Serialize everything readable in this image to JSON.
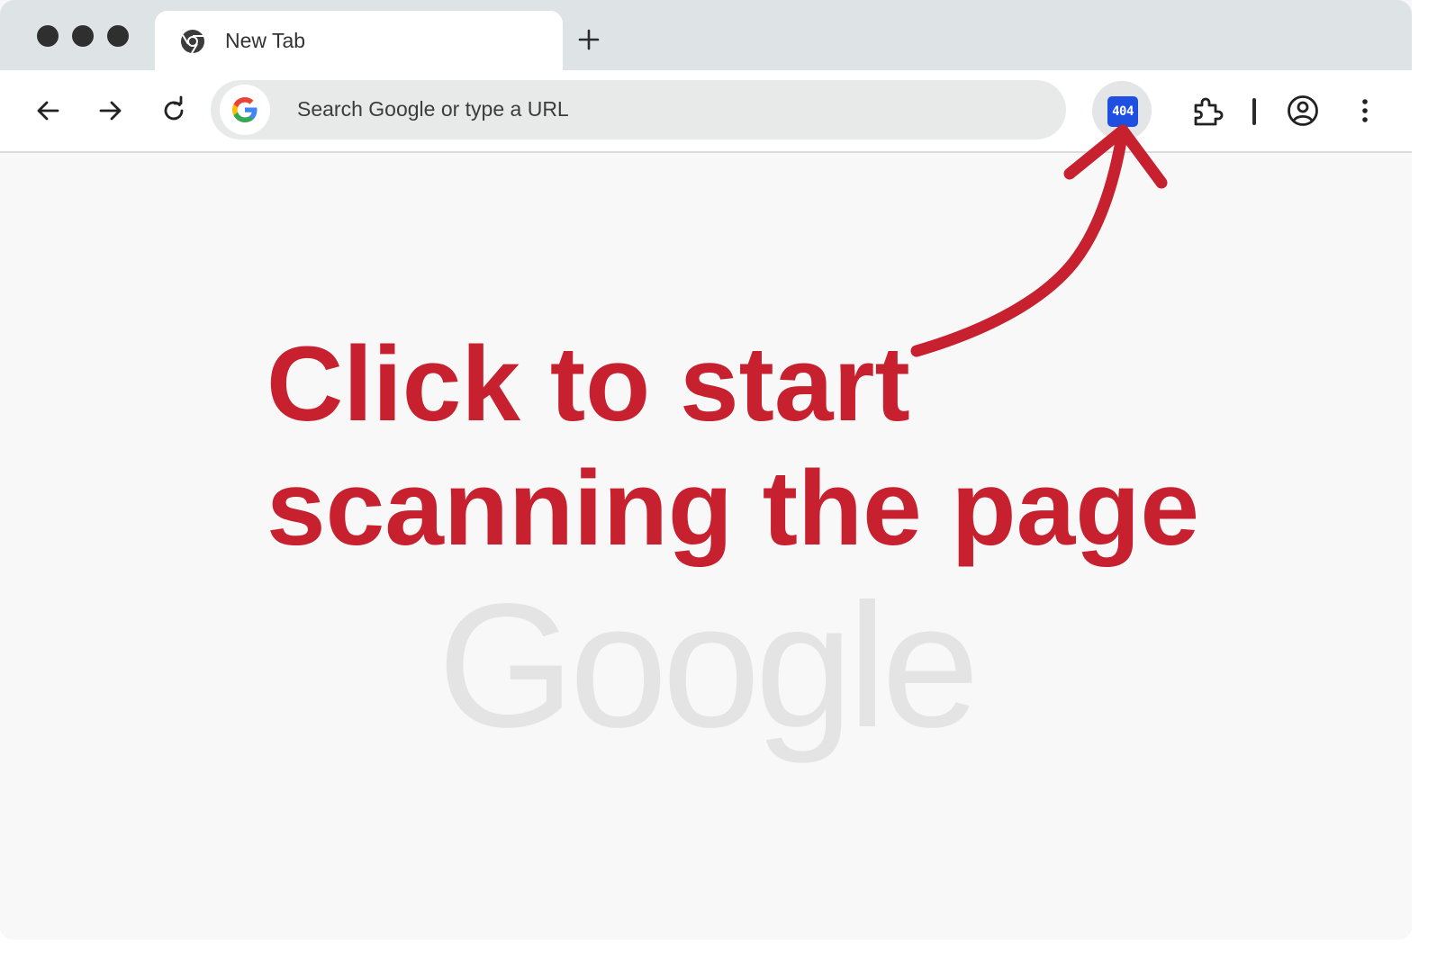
{
  "window": {
    "tab": {
      "title": "New Tab",
      "icon": "chrome-icon"
    },
    "new_tab_icon": "plus-icon"
  },
  "toolbar": {
    "back_icon": "arrow-left-icon",
    "forward_icon": "arrow-right-icon",
    "reload_icon": "reload-icon",
    "omnibox": {
      "search_engine_icon": "google-g-icon",
      "placeholder": "Search Google or type a URL"
    },
    "extension_badge": "404",
    "extensions_icon": "puzzle-icon",
    "profile_icon": "profile-icon",
    "menu_icon": "kebab-menu-icon"
  },
  "content": {
    "headline_line1": "Click to start",
    "headline_line2": "scanning the page",
    "watermark_logo": "Google"
  },
  "colors": {
    "accent_red": "#c7202f",
    "extension_blue": "#1f4fe0",
    "tabstrip_bg": "#dee3e6",
    "page_bg": "#f8f8f8"
  }
}
